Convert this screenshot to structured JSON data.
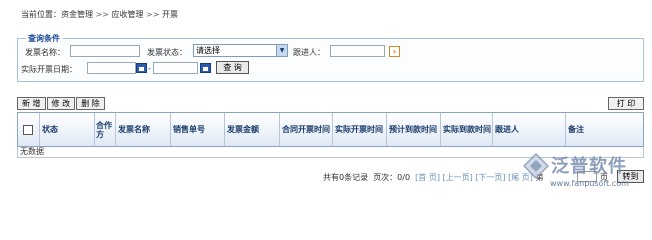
{
  "breadcrumb": {
    "current_label": "当前位置：",
    "level1": "资金管理",
    "sep": ">>",
    "level2": "应收管理",
    "level3": "开票"
  },
  "query": {
    "legend": "查询条件",
    "invoice_name_label": "发票名称：",
    "invoice_name_value": "",
    "invoice_status_label": "发票状态：",
    "invoice_status_value": "请选择",
    "follower_label": "跟进人：",
    "follower_value": "",
    "actual_date_label": "实际开票日期：",
    "actual_date_from": "",
    "range_sep": "-",
    "actual_date_to": "",
    "query_button": "查 询"
  },
  "toolbar": {
    "add": "新 增",
    "edit": "修 改",
    "delete": "删 除",
    "print": "打 印"
  },
  "table": {
    "columns": [
      "状态",
      "合作方",
      "发票名称",
      "销售单号",
      "发票金额",
      "合同开票时间",
      "实际开票时间",
      "预计到款时间",
      "实际到款时间",
      "跟进人",
      "备注"
    ],
    "empty_text": "无数据"
  },
  "pager": {
    "summary": "共有0条记录",
    "page_info": "页次：0/0",
    "first": "[首 页]",
    "prev": "[上一页]",
    "next": "[下一页]",
    "last": "[尾 页]",
    "goto_label": "第",
    "page_suffix": "页",
    "jump": "转到"
  },
  "watermark": {
    "brand": "泛普软件",
    "url": "www.fanpusoft.com"
  }
}
